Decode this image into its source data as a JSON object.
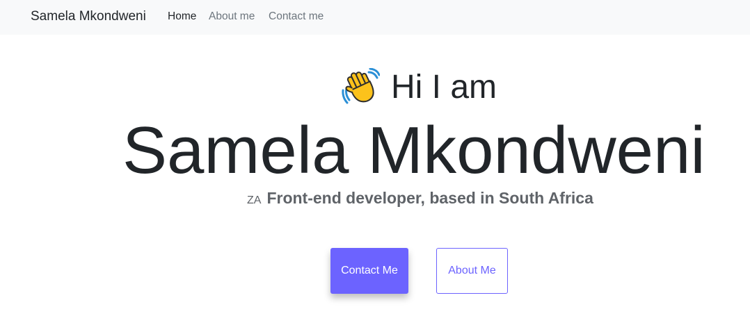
{
  "navbar": {
    "brand": "Samela Mkondweni",
    "links": [
      {
        "label": "Home",
        "active": true
      },
      {
        "label": "About me",
        "active": false
      },
      {
        "label": "Contact me",
        "active": false
      }
    ]
  },
  "hero": {
    "wave_icon": "waving-hand-icon",
    "greeting": "Hi I am",
    "name": "Samela Mkondweni",
    "flag_text": "ZA",
    "tagline": "Front-end developer, based in South Africa",
    "buttons": {
      "contact_label": "Contact Me",
      "about_label": "About Me"
    }
  },
  "colors": {
    "accent": "#6c63ff",
    "navbar_bg": "#f8f9fa",
    "text": "#212529",
    "muted": "#6c757d"
  }
}
